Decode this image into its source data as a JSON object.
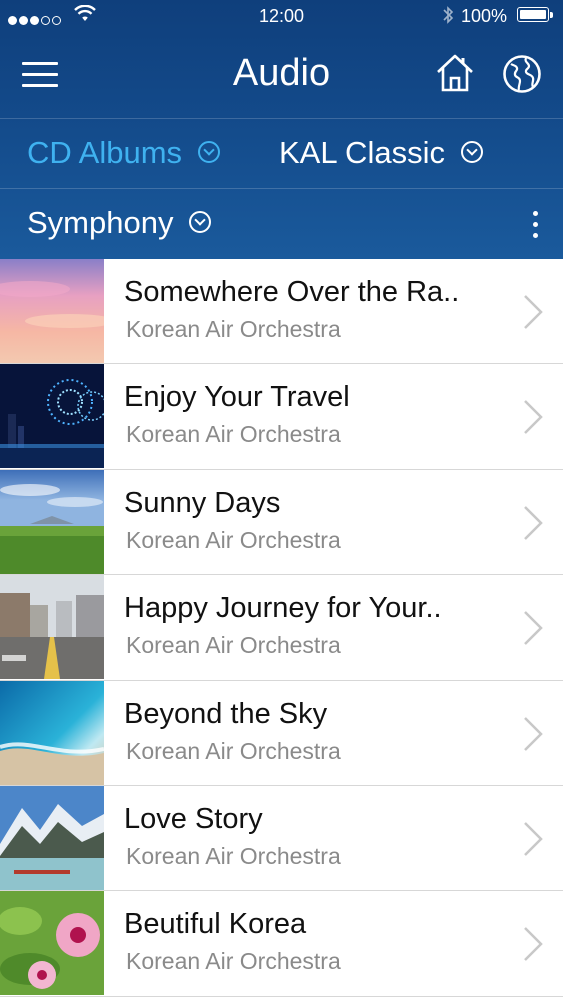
{
  "status": {
    "time": "12:00",
    "battery": "100%"
  },
  "nav": {
    "title": "Audio",
    "icons": [
      "menu-icon",
      "home-icon",
      "globe-icon"
    ]
  },
  "filters": {
    "category": "CD Albums",
    "collection": "KAL Classic",
    "genre": "Symphony"
  },
  "colors": {
    "header": "#134a8a",
    "accent": "#3fb2f0",
    "subtitle": "#8a8a8a"
  },
  "tracks": [
    {
      "title": "Somewhere Over the Ra..",
      "artist": "Korean Air Orchestra",
      "thumb": "sunset-clouds"
    },
    {
      "title": "Enjoy Your Travel",
      "artist": "Korean Air Orchestra",
      "thumb": "city-fireworks"
    },
    {
      "title": "Sunny Days",
      "artist": "Korean Air Orchestra",
      "thumb": "green-field"
    },
    {
      "title": "Happy Journey for Your..",
      "artist": "Korean Air Orchestra",
      "thumb": "city-street"
    },
    {
      "title": "Beyond the Sky",
      "artist": "Korean Air Orchestra",
      "thumb": "ocean-beach"
    },
    {
      "title": "Love Story",
      "artist": "Korean Air Orchestra",
      "thumb": "mountain-lake"
    },
    {
      "title": "Beutiful Korea",
      "artist": "Korean Air Orchestra",
      "thumb": "pink-flower"
    }
  ]
}
